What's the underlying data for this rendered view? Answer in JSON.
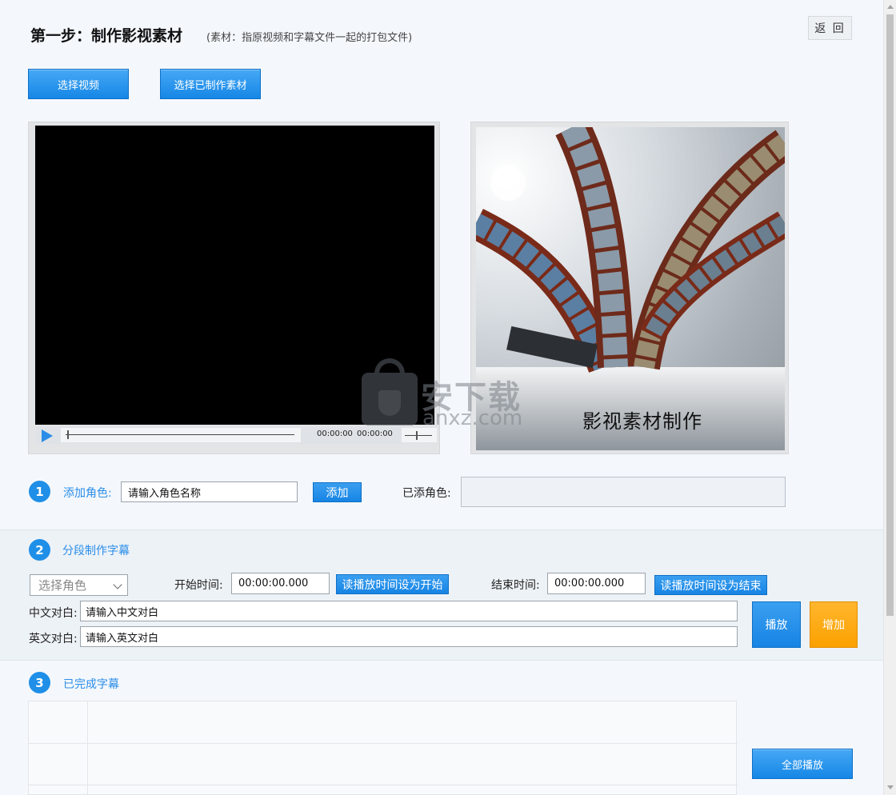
{
  "header": {
    "title": "第一步：制作影视素材",
    "subtitle": "(素材：指原视频和字幕文件一起的打包文件)",
    "back_label": "返 回"
  },
  "toolbar": {
    "select_video_label": "选择视频",
    "select_material_label": "选择已制作素材"
  },
  "player": {
    "current_time": "00:00:00",
    "total_time": "00:00:00",
    "progress": 0
  },
  "poster": {
    "caption": "影视素材制作"
  },
  "watermark": {
    "text": "安下载",
    "sub": "anxz.com"
  },
  "step1": {
    "number": "1",
    "label": "添加角色:",
    "input_value": "请输入角色名称",
    "add_button": "添加",
    "added_label": "已添角色:"
  },
  "step2": {
    "number": "2",
    "label": "分段制作字幕",
    "role_select": "选择角色",
    "start_label": "开始时间:",
    "start_value": "00:00:00.000",
    "set_start_button": "读播放时间设为开始",
    "end_label": "结束时间:",
    "end_value": "00:00:00.000",
    "set_end_button": "读播放时间设为结束",
    "cn_label": "中文对白:",
    "cn_value": "请输入中文对白",
    "en_label": "英文对白:",
    "en_value": "请输入英文对白",
    "play_button": "播放",
    "add_button": "增加"
  },
  "step3": {
    "number": "3",
    "label": "已完成字幕",
    "play_all_button": "全部播放"
  },
  "colors": {
    "accent": "#1f8fe8",
    "orange": "#fba100"
  }
}
